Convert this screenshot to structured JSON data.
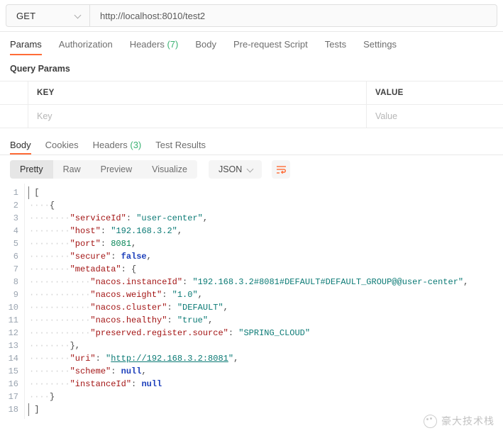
{
  "request_bar": {
    "method": "GET",
    "method_icon": "chevron-down-icon",
    "url": "http://localhost:8010/test2"
  },
  "request_tabs": [
    {
      "label": "Params",
      "count": "",
      "active": true
    },
    {
      "label": "Authorization",
      "count": "",
      "active": false
    },
    {
      "label": "Headers",
      "count": "(7)",
      "active": false
    },
    {
      "label": "Body",
      "count": "",
      "active": false
    },
    {
      "label": "Pre-request Script",
      "count": "",
      "active": false
    },
    {
      "label": "Tests",
      "count": "",
      "active": false
    },
    {
      "label": "Settings",
      "count": "",
      "active": false
    }
  ],
  "query_params": {
    "section_title": "Query Params",
    "columns": [
      "KEY",
      "VALUE"
    ],
    "empty_row": {
      "key_placeholder": "Key",
      "value_placeholder": "Value"
    }
  },
  "response_tabs": [
    {
      "label": "Body",
      "count": "",
      "active": true
    },
    {
      "label": "Cookies",
      "count": "",
      "active": false
    },
    {
      "label": "Headers",
      "count": "(3)",
      "active": false
    },
    {
      "label": "Test Results",
      "count": "",
      "active": false
    }
  ],
  "response_toolbar": {
    "view_modes": [
      {
        "label": "Pretty",
        "active": true
      },
      {
        "label": "Raw",
        "active": false
      },
      {
        "label": "Preview",
        "active": false
      },
      {
        "label": "Visualize",
        "active": false
      }
    ],
    "format": "JSON",
    "format_icon": "chevron-down-icon",
    "wrap_icon": "word-wrap-icon"
  },
  "code_viewer": {
    "line_numbers": [
      "1",
      "2",
      "3",
      "4",
      "5",
      "6",
      "7",
      "8",
      "9",
      "10",
      "11",
      "12",
      "13",
      "14",
      "15",
      "16",
      "17",
      "18"
    ],
    "lines": [
      {
        "n": 1,
        "tokens": [
          {
            "t": "[",
            "c": "p"
          }
        ]
      },
      {
        "n": 2,
        "tokens": [
          {
            "t": "····",
            "c": "ind"
          },
          {
            "t": "{",
            "c": "p"
          }
        ]
      },
      {
        "n": 3,
        "tokens": [
          {
            "t": "········",
            "c": "ind"
          },
          {
            "t": "\"serviceId\"",
            "c": "k"
          },
          {
            "t": ": ",
            "c": "p"
          },
          {
            "t": "\"user-center\"",
            "c": "s"
          },
          {
            "t": ",",
            "c": "p"
          }
        ]
      },
      {
        "n": 4,
        "tokens": [
          {
            "t": "········",
            "c": "ind"
          },
          {
            "t": "\"host\"",
            "c": "k"
          },
          {
            "t": ": ",
            "c": "p"
          },
          {
            "t": "\"192.168.3.2\"",
            "c": "s"
          },
          {
            "t": ",",
            "c": "p"
          }
        ]
      },
      {
        "n": 5,
        "tokens": [
          {
            "t": "········",
            "c": "ind"
          },
          {
            "t": "\"port\"",
            "c": "k"
          },
          {
            "t": ": ",
            "c": "p"
          },
          {
            "t": "8081",
            "c": "n"
          },
          {
            "t": ",",
            "c": "p"
          }
        ]
      },
      {
        "n": 6,
        "tokens": [
          {
            "t": "········",
            "c": "ind"
          },
          {
            "t": "\"secure\"",
            "c": "k"
          },
          {
            "t": ": ",
            "c": "p"
          },
          {
            "t": "false",
            "c": "b"
          },
          {
            "t": ",",
            "c": "p"
          }
        ]
      },
      {
        "n": 7,
        "tokens": [
          {
            "t": "········",
            "c": "ind"
          },
          {
            "t": "\"metadata\"",
            "c": "k"
          },
          {
            "t": ": ",
            "c": "p"
          },
          {
            "t": "{",
            "c": "p"
          }
        ]
      },
      {
        "n": 8,
        "tokens": [
          {
            "t": "············",
            "c": "ind"
          },
          {
            "t": "\"nacos.instanceId\"",
            "c": "k"
          },
          {
            "t": ": ",
            "c": "p"
          },
          {
            "t": "\"192.168.3.2#8081#DEFAULT#DEFAULT_GROUP@@user-center\"",
            "c": "s"
          },
          {
            "t": ",",
            "c": "p"
          }
        ]
      },
      {
        "n": 9,
        "tokens": [
          {
            "t": "············",
            "c": "ind"
          },
          {
            "t": "\"nacos.weight\"",
            "c": "k"
          },
          {
            "t": ": ",
            "c": "p"
          },
          {
            "t": "\"1.0\"",
            "c": "s"
          },
          {
            "t": ",",
            "c": "p"
          }
        ]
      },
      {
        "n": 10,
        "tokens": [
          {
            "t": "············",
            "c": "ind"
          },
          {
            "t": "\"nacos.cluster\"",
            "c": "k"
          },
          {
            "t": ": ",
            "c": "p"
          },
          {
            "t": "\"DEFAULT\"",
            "c": "s"
          },
          {
            "t": ",",
            "c": "p"
          }
        ]
      },
      {
        "n": 11,
        "tokens": [
          {
            "t": "············",
            "c": "ind"
          },
          {
            "t": "\"nacos.healthy\"",
            "c": "k"
          },
          {
            "t": ": ",
            "c": "p"
          },
          {
            "t": "\"true\"",
            "c": "s"
          },
          {
            "t": ",",
            "c": "p"
          }
        ]
      },
      {
        "n": 12,
        "tokens": [
          {
            "t": "············",
            "c": "ind"
          },
          {
            "t": "\"preserved.register.source\"",
            "c": "k"
          },
          {
            "t": ": ",
            "c": "p"
          },
          {
            "t": "\"SPRING_CLOUD\"",
            "c": "s"
          }
        ]
      },
      {
        "n": 13,
        "tokens": [
          {
            "t": "········",
            "c": "ind"
          },
          {
            "t": "},",
            "c": "p"
          }
        ]
      },
      {
        "n": 14,
        "tokens": [
          {
            "t": "········",
            "c": "ind"
          },
          {
            "t": "\"uri\"",
            "c": "k"
          },
          {
            "t": ": ",
            "c": "p"
          },
          {
            "t": "\"",
            "c": "s"
          },
          {
            "t": "http://192.168.3.2:8081",
            "c": "lnk"
          },
          {
            "t": "\"",
            "c": "s"
          },
          {
            "t": ",",
            "c": "p"
          }
        ]
      },
      {
        "n": 15,
        "tokens": [
          {
            "t": "········",
            "c": "ind"
          },
          {
            "t": "\"scheme\"",
            "c": "k"
          },
          {
            "t": ": ",
            "c": "p"
          },
          {
            "t": "null",
            "c": "b"
          },
          {
            "t": ",",
            "c": "p"
          }
        ]
      },
      {
        "n": 16,
        "tokens": [
          {
            "t": "········",
            "c": "ind"
          },
          {
            "t": "\"instanceId\"",
            "c": "k"
          },
          {
            "t": ": ",
            "c": "p"
          },
          {
            "t": "null",
            "c": "b"
          }
        ]
      },
      {
        "n": 17,
        "tokens": [
          {
            "t": "····",
            "c": "ind"
          },
          {
            "t": "}",
            "c": "p"
          }
        ]
      },
      {
        "n": 18,
        "tokens": [
          {
            "t": "]",
            "c": "p"
          }
        ]
      }
    ]
  },
  "watermark": {
    "text": "豪大技术栈",
    "icon": "paw-logo-icon"
  },
  "colors": {
    "accent": "#ff6c37",
    "count_green": "#3bb273",
    "json_key": "#a31515",
    "json_string": "#0b7a75",
    "json_number": "#098658",
    "json_boolean": "#1c3fbb"
  }
}
